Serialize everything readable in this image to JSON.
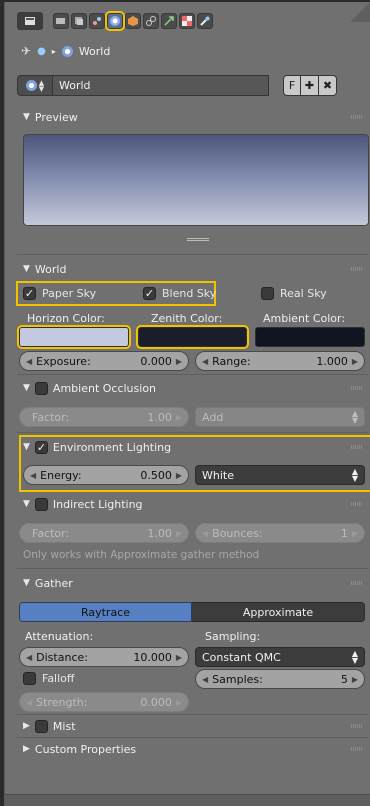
{
  "toolbar": {
    "icons": [
      "render-icon",
      "render-layers-icon",
      "scene-icon",
      "world-icon",
      "object-icon",
      "constraints-icon",
      "modifiers-icon",
      "texture-icon",
      "tool-icon"
    ]
  },
  "breadcrumb": {
    "label": "World"
  },
  "datablock": {
    "name": "World",
    "fake_user": "F"
  },
  "preview_panel": {
    "title": "Preview"
  },
  "world_panel": {
    "title": "World",
    "paper_sky": "Paper Sky",
    "blend_sky": "Blend Sky",
    "real_sky": "Real Sky",
    "horizon_label": "Horizon Color:",
    "zenith_label": "Zenith Color:",
    "ambient_label": "Ambient Color:",
    "exposure_label": "Exposure:",
    "exposure_value": "0.000",
    "range_label": "Range:",
    "range_value": "1.000",
    "colors": {
      "horizon": "#c3c9e0",
      "zenith": "#1a1d2c",
      "ambient": "#101421"
    }
  },
  "ambient_occlusion": {
    "title": "Ambient Occlusion",
    "factor_label": "Factor:",
    "factor_value": "1.00",
    "blend_mode": "Add"
  },
  "environment_lighting": {
    "title": "Environment Lighting",
    "energy_label": "Energy:",
    "energy_value": "0.500",
    "color_mode": "White"
  },
  "indirect_lighting": {
    "title": "Indirect Lighting",
    "factor_label": "Factor:",
    "factor_value": "1.00",
    "bounces_label": "Bounces:",
    "bounces_value": "1",
    "note": "Only works with Approximate gather method"
  },
  "gather": {
    "title": "Gather",
    "raytrace": "Raytrace",
    "approximate": "Approximate",
    "attenuation_label": "Attenuation:",
    "sampling_label": "Sampling:",
    "distance_label": "Distance:",
    "distance_value": "10.000",
    "sampling_method": "Constant QMC",
    "falloff": "Falloff",
    "samples_label": "Samples:",
    "samples_value": "5",
    "strength_label": "Strength:",
    "strength_value": "0.000"
  },
  "mist": {
    "title": "Mist"
  },
  "custom_properties": {
    "title": "Custom Properties"
  }
}
